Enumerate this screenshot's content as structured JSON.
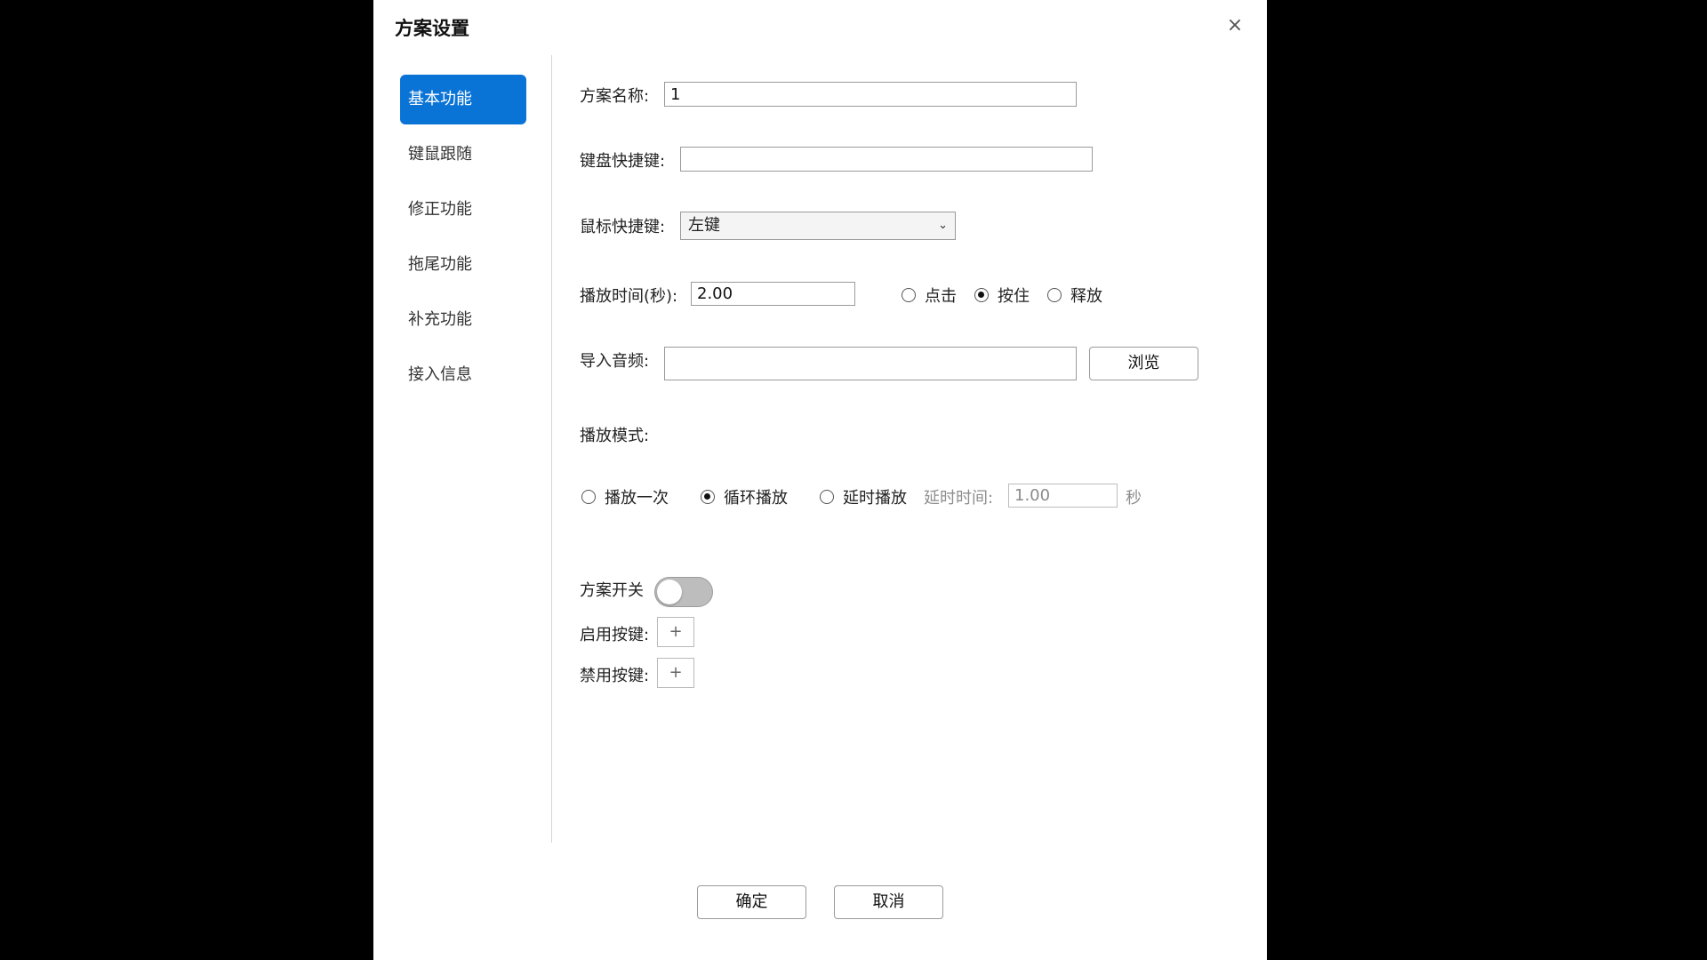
{
  "dialog": {
    "title": "方案设置",
    "close_glyph": "×"
  },
  "sidebar": {
    "items": [
      {
        "label": "基本功能",
        "active": true
      },
      {
        "label": "键鼠跟随",
        "active": false
      },
      {
        "label": "修正功能",
        "active": false
      },
      {
        "label": "拖尾功能",
        "active": false
      },
      {
        "label": "补充功能",
        "active": false
      },
      {
        "label": "接入信息",
        "active": false
      }
    ]
  },
  "form": {
    "scheme_name": {
      "label": "方案名称:",
      "value": "1"
    },
    "keyboard_shortcut": {
      "label": "键盘快捷键:",
      "value": ""
    },
    "mouse_shortcut": {
      "label": "鼠标快捷键:",
      "selected": "左键"
    },
    "play_time": {
      "label": "播放时间(秒):",
      "value": "2.00",
      "options": [
        "点击",
        "按住",
        "释放"
      ],
      "selected": "按住"
    },
    "import_audio": {
      "label": "导入音频:",
      "value": "",
      "browse_label": "浏览"
    },
    "play_mode": {
      "label": "播放模式:",
      "options": [
        "播放一次",
        "循环播放",
        "延时播放"
      ],
      "selected": "循环播放",
      "delay_label": "延时时间:",
      "delay_value": "1.00",
      "delay_unit": "秒"
    },
    "scheme_switch": {
      "label": "方案开关",
      "on": false
    },
    "enable_key": {
      "label": "启用按键:",
      "plus": "+"
    },
    "disable_key": {
      "label": "禁用按键:",
      "plus": "+"
    }
  },
  "footer": {
    "ok_label": "确定",
    "cancel_label": "取消"
  }
}
